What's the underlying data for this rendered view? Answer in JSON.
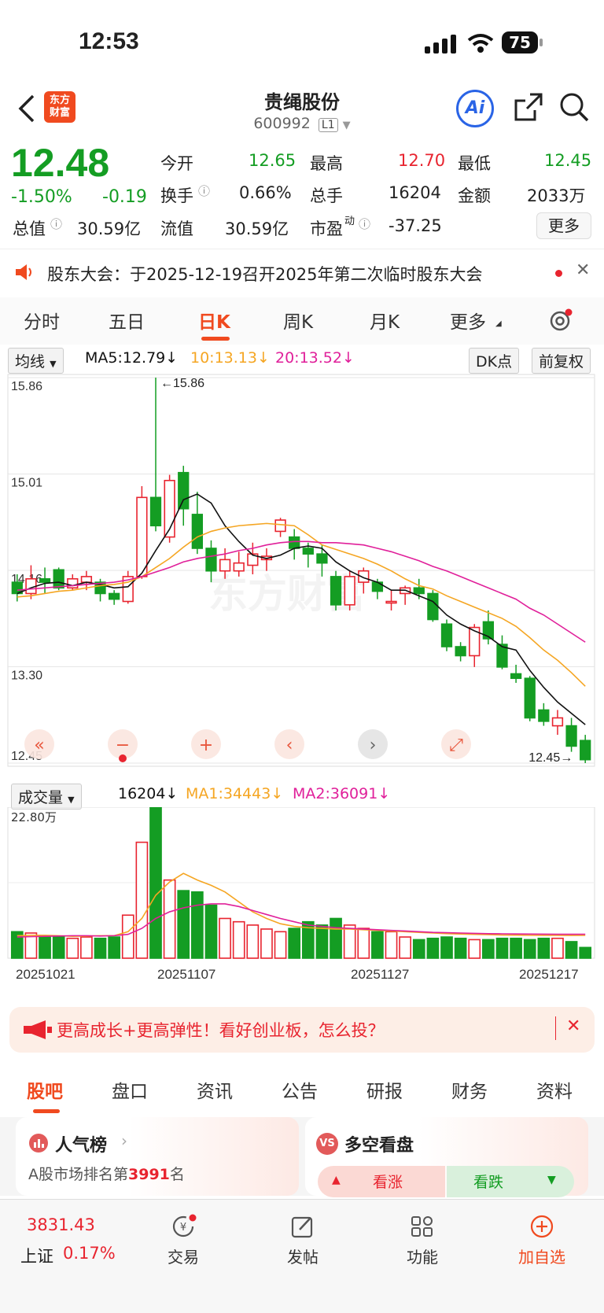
{
  "status": {
    "time": "12:53",
    "battery": "75"
  },
  "nav": {
    "logo_line1": "东方",
    "logo_line2": "财富",
    "title": "贵绳股份",
    "code": "600992",
    "level": "L1",
    "ai_label": "Ai"
  },
  "quote": {
    "price": "12.48",
    "change_pct": "-1.50%",
    "change": "-0.19",
    "open_label": "今开",
    "open": "12.65",
    "high_label": "最高",
    "high": "12.70",
    "low_label": "最低",
    "low": "12.45",
    "turnover_label": "换手",
    "turnover": "0.66%",
    "volume_label": "总手",
    "volume": "16204",
    "amount_label": "金额",
    "amount": "2033万",
    "mktcap_label": "总值",
    "mktcap": "30.59亿",
    "float_label": "流值",
    "float_cap": "30.59亿",
    "pe_label": "市盈",
    "pe_sup": "动",
    "pe": "-37.25",
    "more": "更多"
  },
  "notice": {
    "text": "股东大会：于2025-12-19召开2025年第二次临时股东大会"
  },
  "tabs": [
    "分时",
    "五日",
    "日K",
    "周K",
    "月K",
    "更多"
  ],
  "active_tab": "日K",
  "chart_controls": {
    "ma_select": "均线",
    "ma5": "MA5:12.79",
    "ma10": "10:13.13",
    "ma20": "20:13.52",
    "dk": "DK点",
    "adjust": "前复权",
    "vol_select": "成交量",
    "vol": "16204",
    "vma1": "MA1:34443",
    "vma2": "MA2:36091",
    "watermark": "东方财富"
  },
  "colors": {
    "up": "#e8242f",
    "down": "#149d23",
    "ma5": "#111111",
    "ma10": "#f5a623",
    "ma20": "#e0209a",
    "brand": "#f04a1f"
  },
  "chart_data": [
    {
      "type": "candlestick",
      "y_ticks": [
        "15.86",
        "15.01",
        "14.16",
        "13.30",
        "12.45"
      ],
      "ylim": [
        12.45,
        15.86
      ],
      "max_label": "15.86",
      "min_label": "12.45",
      "x_labels": [
        "20251021",
        "20251107",
        "20251127",
        "20251217"
      ],
      "candles": [
        {
          "o": 14.05,
          "c": 13.95,
          "h": 14.12,
          "l": 13.88
        },
        {
          "o": 13.95,
          "c": 14.08,
          "h": 14.2,
          "l": 13.9
        },
        {
          "o": 14.08,
          "c": 14.05,
          "h": 14.18,
          "l": 13.95
        },
        {
          "o": 14.16,
          "c": 14.0,
          "h": 14.18,
          "l": 13.98
        },
        {
          "o": 14.0,
          "c": 14.08,
          "h": 14.12,
          "l": 13.98
        },
        {
          "o": 14.05,
          "c": 14.1,
          "h": 14.15,
          "l": 13.98
        },
        {
          "o": 14.05,
          "c": 13.95,
          "h": 14.08,
          "l": 13.88
        },
        {
          "o": 13.95,
          "c": 13.9,
          "h": 13.98,
          "l": 13.85
        },
        {
          "o": 13.88,
          "c": 14.1,
          "h": 14.15,
          "l": 13.86
        },
        {
          "o": 14.1,
          "c": 14.8,
          "h": 14.9,
          "l": 14.08
        },
        {
          "o": 14.8,
          "c": 14.55,
          "h": 15.86,
          "l": 14.5
        },
        {
          "o": 14.45,
          "c": 14.95,
          "h": 15.0,
          "l": 14.4
        },
        {
          "o": 15.02,
          "c": 14.7,
          "h": 15.08,
          "l": 14.55
        },
        {
          "o": 14.65,
          "c": 14.35,
          "h": 14.85,
          "l": 14.3
        },
        {
          "o": 14.35,
          "c": 14.15,
          "h": 14.42,
          "l": 14.05
        },
        {
          "o": 14.15,
          "c": 14.25,
          "h": 14.35,
          "l": 14.08
        },
        {
          "o": 14.15,
          "c": 14.22,
          "h": 14.32,
          "l": 14.1
        },
        {
          "o": 14.2,
          "c": 14.3,
          "h": 14.4,
          "l": 14.12
        },
        {
          "o": 14.25,
          "c": 14.28,
          "h": 14.35,
          "l": 14.15
        },
        {
          "o": 14.5,
          "c": 14.6,
          "h": 14.62,
          "l": 14.45
        },
        {
          "o": 14.45,
          "c": 14.35,
          "h": 14.52,
          "l": 14.25
        },
        {
          "o": 14.35,
          "c": 14.3,
          "h": 14.4,
          "l": 14.18
        },
        {
          "o": 14.3,
          "c": 14.22,
          "h": 14.38,
          "l": 14.1
        },
        {
          "o": 14.1,
          "c": 13.85,
          "h": 14.15,
          "l": 13.8
        },
        {
          "o": 13.85,
          "c": 14.1,
          "h": 14.15,
          "l": 13.8
        },
        {
          "o": 14.05,
          "c": 14.15,
          "h": 14.18,
          "l": 13.95
        },
        {
          "o": 14.05,
          "c": 13.97,
          "h": 14.08,
          "l": 13.9
        },
        {
          "o": 13.88,
          "c": 13.88,
          "h": 13.98,
          "l": 13.8
        },
        {
          "o": 13.95,
          "c": 14.0,
          "h": 14.02,
          "l": 13.85
        },
        {
          "o": 14.0,
          "c": 13.95,
          "h": 14.08,
          "l": 13.9
        },
        {
          "o": 13.95,
          "c": 13.72,
          "h": 13.98,
          "l": 13.7
        },
        {
          "o": 13.68,
          "c": 13.48,
          "h": 13.72,
          "l": 13.44
        },
        {
          "o": 13.48,
          "c": 13.4,
          "h": 13.52,
          "l": 13.35
        },
        {
          "o": 13.4,
          "c": 13.65,
          "h": 13.68,
          "l": 13.3
        },
        {
          "o": 13.7,
          "c": 13.55,
          "h": 13.8,
          "l": 13.5
        },
        {
          "o": 13.5,
          "c": 13.3,
          "h": 13.58,
          "l": 13.28
        },
        {
          "o": 13.24,
          "c": 13.2,
          "h": 13.32,
          "l": 13.16
        },
        {
          "o": 13.2,
          "c": 12.85,
          "h": 13.22,
          "l": 12.82
        },
        {
          "o": 12.92,
          "c": 12.82,
          "h": 12.98,
          "l": 12.78
        },
        {
          "o": 12.78,
          "c": 12.85,
          "h": 12.92,
          "l": 12.7
        },
        {
          "o": 12.78,
          "c": 12.6,
          "h": 12.85,
          "l": 12.55
        },
        {
          "o": 12.65,
          "c": 12.48,
          "h": 12.7,
          "l": 12.45
        }
      ],
      "ma5": [
        13.95,
        14.0,
        14.04,
        14.05,
        14.02,
        14.05,
        14.03,
        14.0,
        14.01,
        14.13,
        14.33,
        14.52,
        14.78,
        14.83,
        14.75,
        14.55,
        14.41,
        14.29,
        14.26,
        14.29,
        14.35,
        14.37,
        14.35,
        14.23,
        14.15,
        14.09,
        14.05,
        13.98,
        13.98,
        13.93,
        13.88,
        13.76,
        13.68,
        13.62,
        13.57,
        13.48,
        13.45,
        13.27,
        13.12,
        12.99,
        12.89,
        12.79
      ],
      "ma10": [
        13.92,
        13.93,
        13.95,
        13.97,
        13.98,
        14.0,
        14.02,
        14.03,
        14.05,
        14.1,
        14.18,
        14.26,
        14.36,
        14.45,
        14.5,
        14.53,
        14.55,
        14.56,
        14.57,
        14.56,
        14.55,
        14.47,
        14.38,
        14.34,
        14.3,
        14.26,
        14.21,
        14.15,
        14.08,
        14.02,
        13.99,
        13.93,
        13.88,
        13.83,
        13.78,
        13.73,
        13.66,
        13.56,
        13.45,
        13.36,
        13.25,
        13.13
      ],
      "ma20": [
        13.98,
        13.99,
        14.0,
        14.01,
        14.02,
        14.03,
        14.04,
        14.05,
        14.07,
        14.1,
        14.14,
        14.18,
        14.23,
        14.26,
        14.28,
        14.3,
        14.33,
        14.35,
        14.38,
        14.4,
        14.41,
        14.41,
        14.4,
        14.4,
        14.39,
        14.38,
        14.35,
        14.32,
        14.28,
        14.24,
        14.19,
        14.15,
        14.1,
        14.05,
        14.0,
        13.95,
        13.9,
        13.82,
        13.76,
        13.68,
        13.6,
        13.52
      ]
    },
    {
      "type": "bar",
      "title": "成交量",
      "y_max_label": "22.80万",
      "ylim": [
        0,
        228000
      ],
      "values": [
        40000,
        38000,
        34000,
        33000,
        30000,
        32000,
        30000,
        32000,
        65000,
        175000,
        228000,
        118000,
        102000,
        100000,
        80000,
        60000,
        55000,
        50000,
        44000,
        40000,
        45000,
        55000,
        50000,
        60000,
        50000,
        45000,
        40000,
        40000,
        32000,
        28000,
        30000,
        32000,
        30000,
        28000,
        28000,
        30000,
        30000,
        28000,
        30000,
        30000,
        25000,
        16204
      ],
      "ma1": [
        34000,
        34500,
        34500,
        34000,
        33000,
        33500,
        34000,
        34000,
        40000,
        60000,
        95000,
        115000,
        128000,
        118000,
        110000,
        100000,
        85000,
        70000,
        60000,
        52000,
        48000,
        46000,
        45000,
        44000,
        44000,
        43000,
        42000,
        41000,
        40000,
        39000,
        38000,
        37000,
        36500,
        36000,
        35500,
        35000,
        34800,
        34600,
        34500,
        34500,
        34400,
        34443
      ],
      "ma2": [
        32000,
        32500,
        33000,
        33500,
        34000,
        34000,
        33500,
        34000,
        36000,
        45000,
        60000,
        70000,
        76000,
        80000,
        82000,
        82000,
        78000,
        72000,
        66000,
        60000,
        55000,
        50000,
        48000,
        46000,
        45000,
        44000,
        43000,
        42000,
        41000,
        40000,
        39000,
        38500,
        38000,
        37500,
        37000,
        36800,
        36600,
        36400,
        36300,
        36200,
        36100,
        36091
      ]
    }
  ],
  "banner": {
    "text": "更高成长+更高弹性！看好创业板，怎么投？"
  },
  "bottom_tabs": [
    "股吧",
    "盘口",
    "资讯",
    "公告",
    "研报",
    "财务",
    "资料"
  ],
  "cards": {
    "left_title": "人气榜",
    "left_text": "A股市场排名第",
    "left_rank": "3991",
    "left_suffix": "名",
    "right_title": "多空看盘",
    "right_badge": "VS",
    "bull": "看涨",
    "bear": "看跌"
  },
  "footer": {
    "index_value": "3831.43",
    "index_name": "上证",
    "index_change": "0.17%",
    "trade": "交易",
    "post": "发帖",
    "func": "功能",
    "add": "加自选"
  }
}
